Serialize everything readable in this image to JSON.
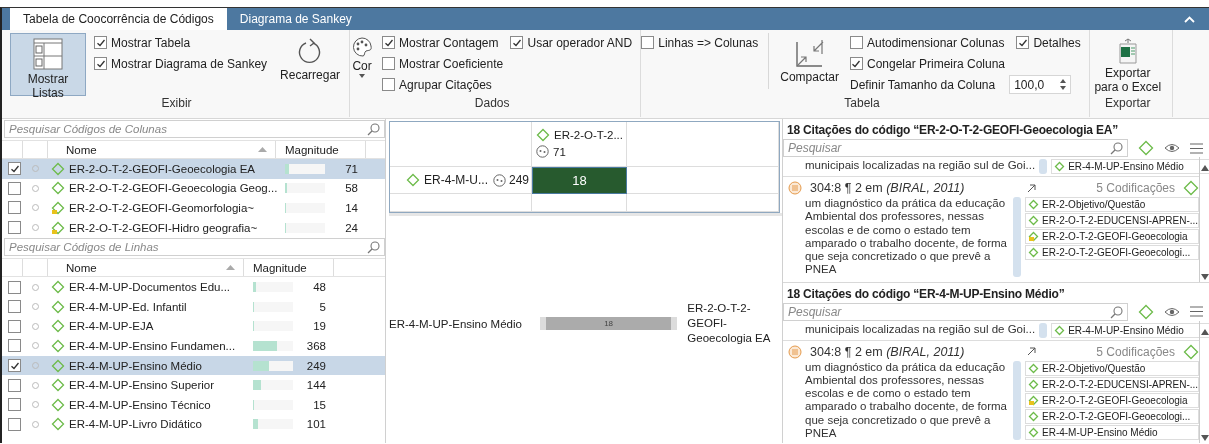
{
  "tabs": [
    {
      "label": "Tabela de Coocorrência de Códigos",
      "selected": true
    },
    {
      "label": "Diagrama de Sankey",
      "selected": false
    }
  ],
  "ribbon": {
    "groups": [
      {
        "label": "Exibir",
        "items": [
          {
            "kind": "big_button",
            "label": "Mostrar Listas",
            "pressed": true
          },
          {
            "kind": "column",
            "rows": [
              [
                {
                  "kind": "check",
                  "label": "Mostrar Tabela",
                  "checked": true
                }
              ],
              [
                {
                  "kind": "check",
                  "label": "Mostrar Diagrama de Sankey",
                  "checked": true
                }
              ]
            ]
          },
          {
            "kind": "big_button",
            "label": "Recarregar",
            "pressed": false
          }
        ]
      },
      {
        "label": "Dados",
        "items": [
          {
            "kind": "dropdown_button",
            "label": "Cor"
          },
          {
            "kind": "column",
            "rows": [
              [
                {
                  "kind": "check",
                  "label": "Mostrar Contagem",
                  "checked": true
                },
                {
                  "kind": "check",
                  "label": "Usar operador AND",
                  "checked": true
                }
              ],
              [
                {
                  "kind": "check",
                  "label": "Mostrar Coeficiente",
                  "checked": false
                }
              ],
              [
                {
                  "kind": "check",
                  "label": "Agrupar Citações",
                  "checked": false
                }
              ]
            ]
          }
        ]
      },
      {
        "label": "Tabela",
        "items": [
          {
            "kind": "column",
            "rows": [
              [
                {
                  "kind": "check",
                  "label": "Linhas => Colunas",
                  "checked": false
                }
              ]
            ]
          },
          {
            "kind": "separator"
          },
          {
            "kind": "big_button",
            "label": "Compactar",
            "pressed": false
          },
          {
            "kind": "column",
            "rows": [
              [
                {
                  "kind": "check",
                  "label": "Autodimensionar Colunas",
                  "checked": false
                },
                {
                  "kind": "check",
                  "label": "Detalhes",
                  "checked": true
                }
              ],
              [
                {
                  "kind": "check",
                  "label": "Congelar Primeira Coluna",
                  "checked": true
                }
              ],
              [
                {
                  "kind": "spinner",
                  "label": "Definir Tamanho da Coluna",
                  "value": "100,0"
                }
              ]
            ]
          }
        ]
      },
      {
        "label": "Exportar",
        "items": [
          {
            "kind": "big_button",
            "label": "Exportar para o Excel",
            "pressed": false
          }
        ]
      }
    ]
  },
  "code_lists": [
    {
      "search_placeholder": "Pesquisar Códigos de Colunas",
      "headers": [
        "Nome",
        "Magnitude"
      ],
      "rows": [
        {
          "name": "ER-2-O-T-2-GEOFI-Geoecologia EA",
          "magnitude": "71",
          "level": 0.1,
          "checked": true,
          "selected": true,
          "memo": false
        },
        {
          "name": "ER-2-O-T-2-GEOFI-Geoecologia Geog...",
          "magnitude": "58",
          "level": 0.05,
          "checked": false,
          "selected": false,
          "memo": false
        },
        {
          "name": "ER-2-O-T-2-GEOFI-Geomorfologia~",
          "magnitude": "14",
          "level": 0.025,
          "checked": false,
          "selected": false,
          "memo": true
        },
        {
          "name": "ER-2-O-T-2-GEOFI-Hidro geografia~",
          "magnitude": "24",
          "level": 0.025,
          "checked": false,
          "selected": false,
          "memo": true
        }
      ]
    },
    {
      "search_placeholder": "Pesquisar Códigos de Linhas",
      "headers": [
        "Nome",
        "Magnitude"
      ],
      "rows": [
        {
          "name": "ER-4-M-UP-Documentos Edu...",
          "magnitude": "48",
          "level": 0.08,
          "checked": false,
          "selected": false,
          "memo": false
        },
        {
          "name": "ER-4-M-UP-Ed. Infantil",
          "magnitude": "5",
          "level": 0.02,
          "checked": false,
          "selected": false,
          "memo": false
        },
        {
          "name": "ER-4-M-UP-EJA",
          "magnitude": "19",
          "level": 0.025,
          "checked": false,
          "selected": false,
          "memo": false
        },
        {
          "name": "ER-4-M-UP-Ensino Fundamen...",
          "magnitude": "368",
          "level": 0.6,
          "checked": false,
          "selected": false,
          "memo": false
        },
        {
          "name": "ER-4-M-UP-Ensino Médio",
          "magnitude": "249",
          "level": 0.4,
          "checked": true,
          "selected": true,
          "memo": false
        },
        {
          "name": "ER-4-M-UP-Ensino Superior",
          "magnitude": "144",
          "level": 0.2,
          "checked": false,
          "selected": false,
          "memo": false
        },
        {
          "name": "ER-4-M-UP-Ensino Técnico",
          "magnitude": "15",
          "level": 0.025,
          "checked": false,
          "selected": false,
          "memo": false
        },
        {
          "name": "ER-4-M-UP-Livro Didático",
          "magnitude": "101",
          "level": 0.13,
          "checked": false,
          "selected": false,
          "memo": false
        }
      ]
    }
  ],
  "matrix": {
    "column_header": {
      "name": "ER-2-O-T-2...",
      "count": "71"
    },
    "row_header": {
      "name": "ER-4-M-U...",
      "count": "249"
    },
    "cell": "18"
  },
  "sankey": {
    "source": "ER-4-M-UP-Ensino Médio",
    "flow": "18",
    "target": "ER-2-O-T-2-GEOFI-Geoecologia EA"
  },
  "citation_panels": [
    {
      "title": "18 Citações do código “ER-2-O-T-2-GEOFI-Geoecologia EA”",
      "search_placeholder": "Pesquisar",
      "items": [
        {
          "kind": "partial",
          "text": "municipais localizadas na região sul de Goi...",
          "codes": [
            {
              "name": "ER-4-M-UP-Ensino Médio",
              "memo": false
            }
          ]
        },
        {
          "kind": "full",
          "ref": "304:8 ¶ 2 em *(BIRAL, 2011)*",
          "codings": "5 Codificações",
          "text": "um diagnóstico da prática da educação Ambiental dos professores, nessas escolas e de como o estado tem amparado o trabalho docente, de forma que seja concretizado o que prevê a PNEA",
          "codes": [
            {
              "name": "ER-2-Objetivo/Questão",
              "memo": false
            },
            {
              "name": "ER-2-O-T-2-EDUCENSI-APREN-...",
              "memo": false
            },
            {
              "name": "ER-2-O-T-2-GEOFI-Geoecologia",
              "memo": true
            },
            {
              "name": "ER-2-O-T-2-GEOFI-Geoecologi...",
              "memo": false
            }
          ]
        }
      ]
    },
    {
      "title": "18 Citações do código “ER-4-M-UP-Ensino Médio”",
      "search_placeholder": "Pesquisar",
      "items": [
        {
          "kind": "partial",
          "text": "municipais localizadas na região sul de Goi...",
          "codes": [
            {
              "name": "ER-4-M-UP-Ensino Médio",
              "memo": false
            }
          ]
        },
        {
          "kind": "full",
          "ref": "304:8 ¶ 2 em *(BIRAL, 2011)*",
          "codings": "5 Codificações",
          "text": "um diagnóstico da prática da educação Ambiental dos professores, nessas escolas e de como o estado tem amparado o trabalho docente, de forma que seja concretizado o que prevê a PNEA",
          "codes": [
            {
              "name": "ER-2-Objetivo/Questão",
              "memo": false
            },
            {
              "name": "ER-2-O-T-2-EDUCENSI-APREN-...",
              "memo": false
            },
            {
              "name": "ER-2-O-T-2-GEOFI-Geoecologia",
              "memo": true
            },
            {
              "name": "ER-2-O-T-2-GEOFI-Geoecologi...",
              "memo": false
            },
            {
              "name": "ER-4-M-UP-Ensino Médio",
              "memo": false
            }
          ]
        }
      ]
    }
  ]
}
